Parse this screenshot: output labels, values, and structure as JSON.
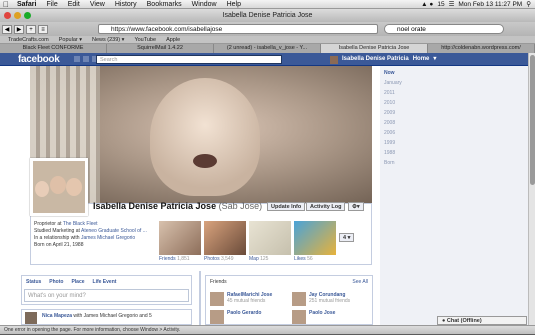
{
  "menubar": {
    "app": "Safari",
    "items": [
      "File",
      "Edit",
      "View",
      "History",
      "Bookmarks",
      "Window",
      "Help"
    ],
    "battery_number": "15",
    "clock": "Mon Feb 13  11:27 PM"
  },
  "window": {
    "title": "Isabella Denise Patricia Jose"
  },
  "toolbar": {
    "url": "https://www.facebook.com/isabellajose",
    "search_value": "noel orate"
  },
  "bookmarks": [
    "TradeCrafts.com",
    "Popular ▾",
    "News (239) ▾",
    "YouTube",
    "Apple"
  ],
  "tabs": [
    {
      "label": "Black Fleet CONFORME",
      "active": false
    },
    {
      "label": "SquirrelMail 1.4.22",
      "active": false
    },
    {
      "label": "(2 unread) - isabella_v_jose - Y...",
      "active": false
    },
    {
      "label": "Isabella Denise Patricia Jose",
      "active": true
    },
    {
      "label": "http://coldenabn.wordpress.com/",
      "active": false
    }
  ],
  "fb": {
    "logo": "facebook",
    "search_placeholder": "Search",
    "user_name": "Isabella Denise Patricia",
    "home": "Home",
    "profile_name": "Isabella Denise Patricia Jose",
    "profile_alt": "(Sab Jose)",
    "update_info": "Update Info",
    "activity_log": "Activity Log",
    "facts": [
      {
        "text": "Proprietor at ",
        "link": "The Black Fleet"
      },
      {
        "text": "Studied Marketing at ",
        "link": "Ateneo Graduate School of ..."
      },
      {
        "text": "In a relationship with ",
        "link": "James Michael Gregorio"
      },
      {
        "text": "Born on April 21, 1988",
        "link": ""
      }
    ],
    "thumbs": [
      {
        "label": "Friends",
        "count": "1,851"
      },
      {
        "label": "Photos",
        "count": "3,549"
      },
      {
        "label": "Map",
        "count": "125"
      },
      {
        "label": "Likes",
        "count": "56"
      }
    ],
    "more_count": "4",
    "timeline_years": [
      "Now",
      "January",
      "2011",
      "2010",
      "2009",
      "2008",
      "2006",
      "1999",
      "1988",
      "Born"
    ],
    "composer": {
      "tabs": [
        "Status",
        "Photo",
        "Place",
        "Life Event"
      ],
      "placeholder": "What's on your mind?"
    },
    "friends_box": {
      "title": "Friends",
      "see_all": "See All",
      "items": [
        {
          "name": "RafaelMarichi Jose",
          "mutual": "45 mutual friends"
        },
        {
          "name": "Jay Corundang",
          "mutual": "251 mutual friends"
        },
        {
          "name": "Paolo Gerardo",
          "mutual": ""
        },
        {
          "name": "Paolo Jose",
          "mutual": ""
        }
      ]
    },
    "story": {
      "name": "Nica Mapeza",
      "text": " with James Michael Gregorio and 5"
    },
    "chat": "Chat (Offline)"
  },
  "statusbar": "One error in opening the page. For more information, choose Window > Activity.",
  "colors": {
    "fb_blue": "#3b5998",
    "link": "#3b5998"
  }
}
